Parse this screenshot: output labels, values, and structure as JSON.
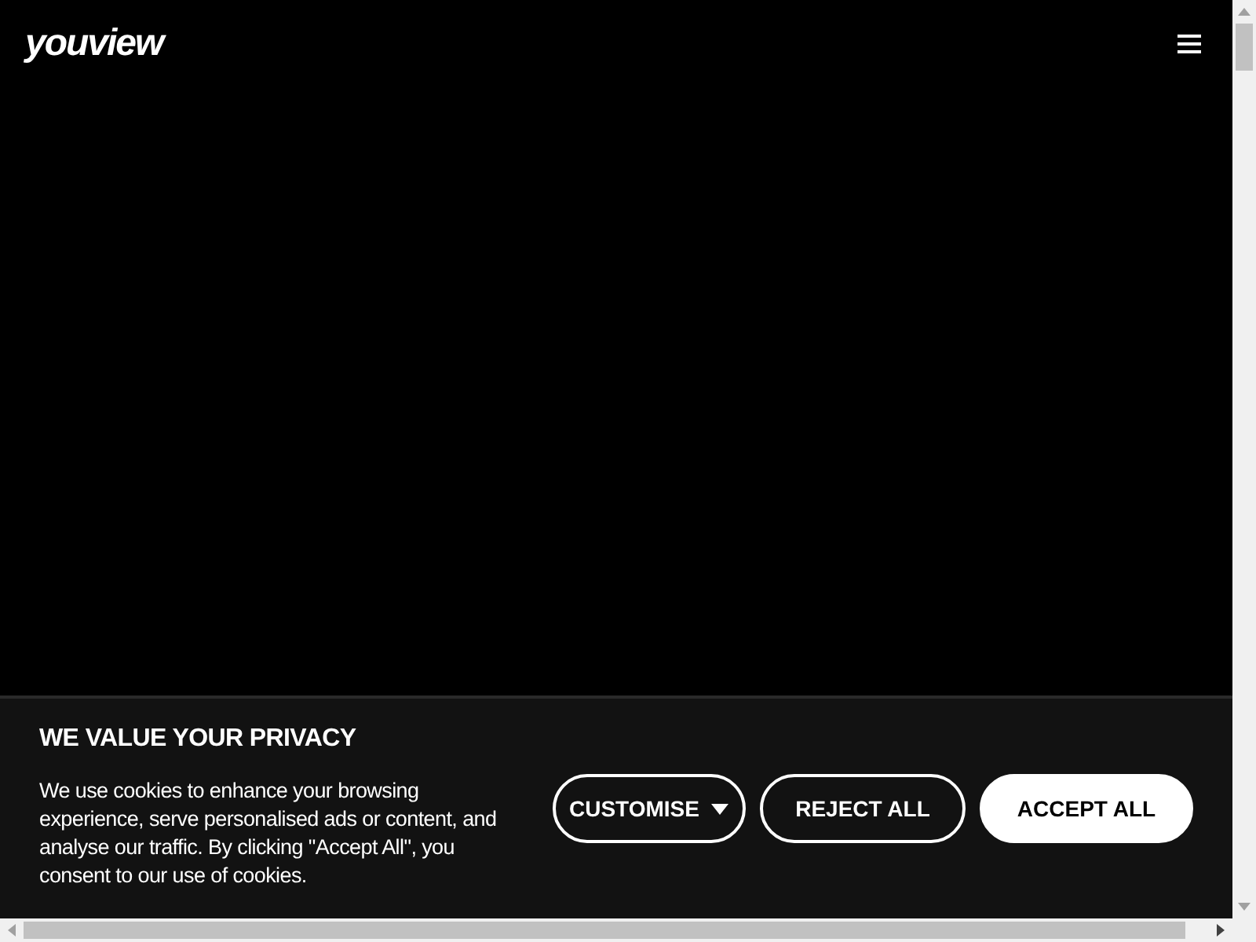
{
  "header": {
    "logo": "youview"
  },
  "cookie_banner": {
    "title": "WE VALUE YOUR PRIVACY",
    "text": "We use cookies to enhance your browsing experience, serve personalised ads or content, and analyse our traffic. By clicking \"Accept All\", you consent to our use of cookies.",
    "buttons": [
      {
        "label": "CUSTOMISE",
        "kind": "dropdown"
      },
      {
        "label": "REJECT ALL",
        "kind": "outline"
      },
      {
        "label": "ACCEPT ALL",
        "kind": "filled"
      }
    ]
  }
}
